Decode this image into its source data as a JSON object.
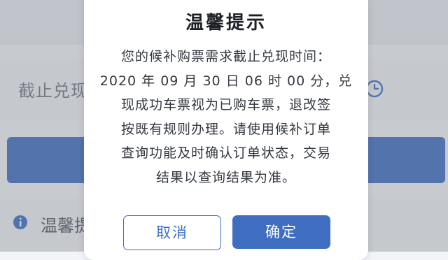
{
  "background": {
    "deadline_label": "截止兑现",
    "tips_title": "温馨提"
  },
  "dialog": {
    "title": "温馨提示",
    "body_lines": [
      "您的候补购票需求截止兑现时间：",
      "2020 年 09 月 30 日 06 时 00 分，兑",
      "现成功车票视为已购车票，退改签",
      "按既有规则办理。请使用候补订单",
      "查询功能及时确认订单状态，交易",
      "结果以查询结果为准。"
    ],
    "cancel_label": "取消",
    "confirm_label": "确定"
  },
  "colors": {
    "accent": "#3f6ec0",
    "hint_arrow": "#e0322a"
  },
  "icons": [
    "clock-icon",
    "info-icon",
    "arrow-hint-icon"
  ]
}
